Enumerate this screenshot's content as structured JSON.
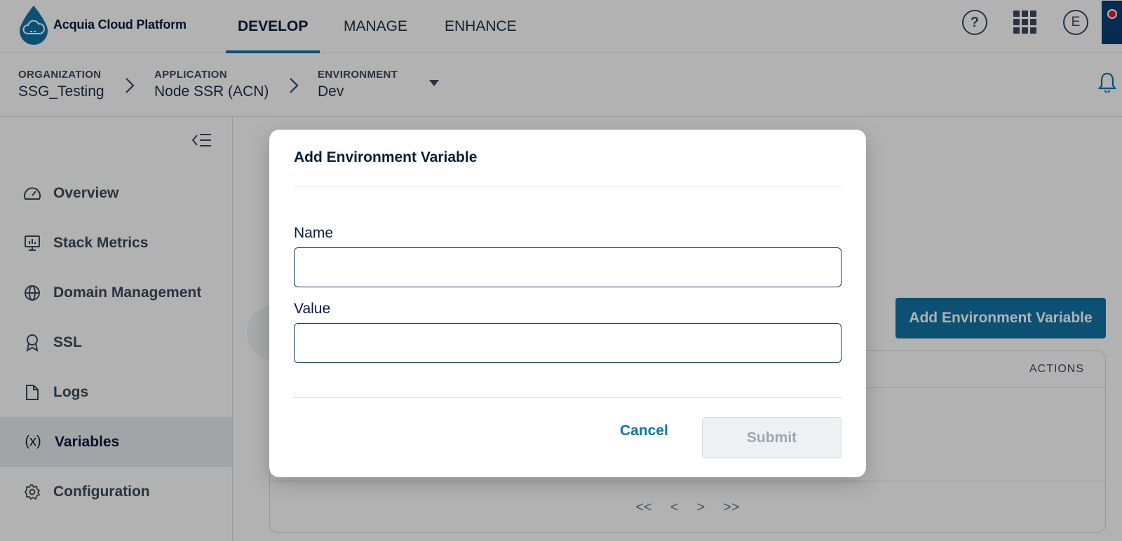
{
  "app": {
    "brand": "Acquia Cloud Platform"
  },
  "topnav": {
    "tabs": [
      {
        "label": "DEVELOP",
        "active": true
      },
      {
        "label": "MANAGE",
        "active": false
      },
      {
        "label": "ENHANCE",
        "active": false
      }
    ],
    "help_glyph": "?",
    "user_initial": "E"
  },
  "breadcrumb": {
    "organization": {
      "label": "ORGANIZATION",
      "value": "SSG_Testing"
    },
    "application": {
      "label": "APPLICATION",
      "value": "Node SSR (ACN)"
    },
    "environment": {
      "label": "ENVIRONMENT",
      "value": "Dev"
    }
  },
  "sidebar": {
    "items": [
      {
        "label": "Overview",
        "icon": "gauge-icon",
        "active": false
      },
      {
        "label": "Stack Metrics",
        "icon": "monitor-chart-icon",
        "active": false
      },
      {
        "label": "Domain Management",
        "icon": "globe-icon",
        "active": false
      },
      {
        "label": "SSL",
        "icon": "ribbon-icon",
        "active": false
      },
      {
        "label": "Logs",
        "icon": "file-icon",
        "active": false
      },
      {
        "label": "Variables",
        "icon": "variable-icon",
        "active": true,
        "glyph": "(x)"
      },
      {
        "label": "Configuration",
        "icon": "gear-icon",
        "active": false
      }
    ]
  },
  "main": {
    "add_button_label": "Add Environment Variable",
    "table_actions_header": "ACTIONS",
    "pagination": {
      "first": "<<",
      "prev": "<",
      "next": ">",
      "last": ">>"
    }
  },
  "modal": {
    "title": "Add Environment Variable",
    "name_label": "Name",
    "name_value": "",
    "value_label": "Value",
    "value_value": "",
    "cancel_label": "Cancel",
    "submit_label": "Submit"
  },
  "colors": {
    "primary": "#1273a6",
    "text_dark": "#0b1c3a",
    "text_muted": "#3b4a5e",
    "border": "#d6dbe0"
  }
}
